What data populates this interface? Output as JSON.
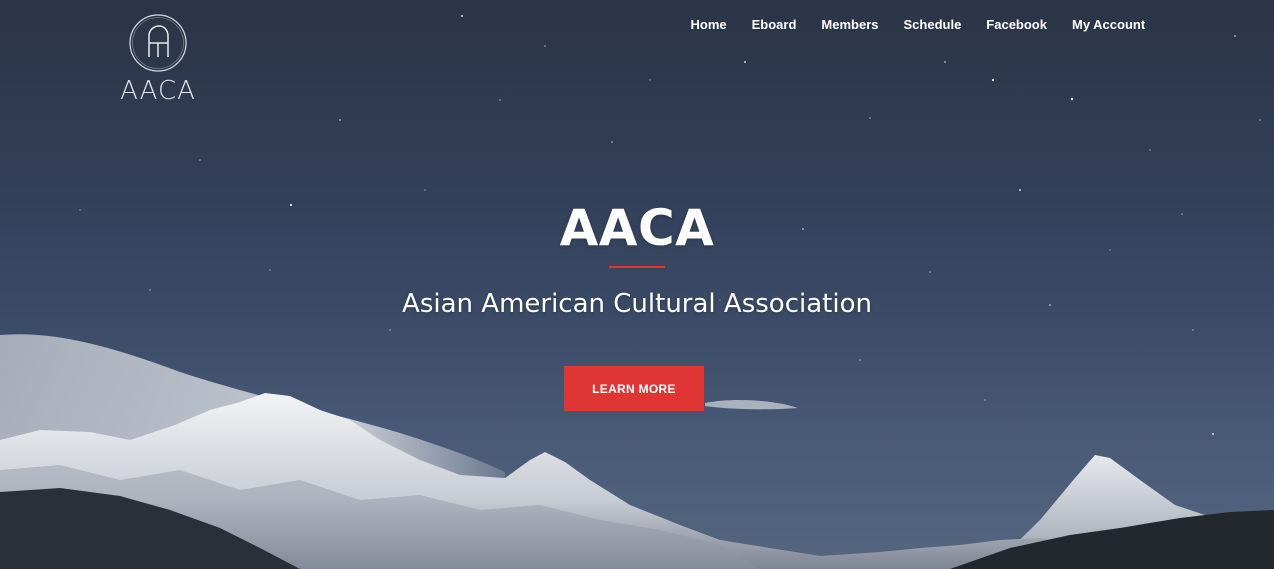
{
  "brand": {
    "name": "AACA",
    "logo_icon": "aaca-monogram-icon"
  },
  "nav": {
    "items": [
      {
        "label": "Home"
      },
      {
        "label": "Eboard"
      },
      {
        "label": "Members"
      },
      {
        "label": "Schedule"
      },
      {
        "label": "Facebook"
      },
      {
        "label": "My Account"
      }
    ]
  },
  "hero": {
    "title": "AACA",
    "subtitle": "Asian American Cultural Association",
    "cta_label": "LEARN MORE",
    "background": "starry-night-mountains-image"
  },
  "colors": {
    "accent": "#e03535",
    "sky": "#33405a",
    "text": "#ffffff"
  }
}
